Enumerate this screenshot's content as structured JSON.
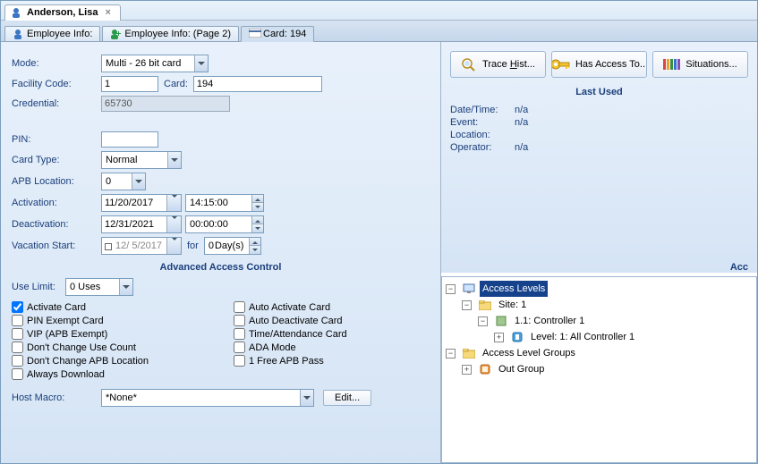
{
  "title_tab": {
    "label": "Anderson, Lisa"
  },
  "subtabs": {
    "employee_info_label": "Employee Info:",
    "employee_info_p2_label": "Employee Info: (Page 2)",
    "card_label": "Card: 194"
  },
  "form": {
    "mode_label": "Mode:",
    "mode_value": "Multi - 26 bit card",
    "facility_code_label": "Facility Code:",
    "facility_code_value": "1",
    "card_label": "Card:",
    "card_value": "194",
    "credential_label": "Credential:",
    "credential_value": "65730",
    "pin_label": "PIN:",
    "pin_value": "",
    "card_type_label": "Card Type:",
    "card_type_value": "Normal",
    "apb_location_label": "APB Location:",
    "apb_location_value": "0",
    "activation_label": "Activation:",
    "activation_date": "11/20/2017",
    "activation_time": "14:15:00",
    "deactivation_label": "Deactivation:",
    "deactivation_date": "12/31/2021",
    "deactivation_time": "00:00:00",
    "vacation_label": "Vacation Start:",
    "vacation_date": "12/ 5/2017",
    "vacation_for_label": "for",
    "vacation_days_value": "0",
    "vacation_days_suffix": "Day(s)"
  },
  "adv_header": "Advanced Access Control",
  "use_limit_label": "Use Limit:",
  "use_limit_value": "0 Uses",
  "checks_left": {
    "activate_card": "Activate Card",
    "pin_exempt": "PIN Exempt Card",
    "vip_apb": "VIP (APB Exempt)",
    "dont_change_use": "Don't Change Use Count",
    "dont_change_apb": "Don't Change APB Location",
    "always_download": "Always Download"
  },
  "checks_right": {
    "auto_activate": "Auto Activate Card",
    "auto_deactivate": "Auto Deactivate Card",
    "time_attendance": "Time/Attendance Card",
    "ada_mode": "ADA Mode",
    "free_apb": "1 Free APB Pass"
  },
  "host_macro_label": "Host Macro:",
  "host_macro_value": "*None*",
  "edit_btn": "Edit...",
  "right": {
    "trace_hist": "Trace ",
    "trace_hist_u": "H",
    "trace_hist_tail": "ist...",
    "has_access": "Has Access To...",
    "situations": "Situations...",
    "last_used_title": "Last Used",
    "datetime_label": "Date/Time:",
    "datetime_val": "n/a",
    "event_label": "Event:",
    "event_val": "n/a",
    "location_label": "Location:",
    "operator_label": "Operator:",
    "operator_val": "n/a",
    "acc_label": "Acc"
  },
  "tree": {
    "root1": "Access Levels",
    "site": "Site: 1",
    "controller": "1.1: Controller 1",
    "level": "Level: 1: All Controller 1",
    "root2": "Access Level Groups",
    "outgroup": "Out Group"
  }
}
